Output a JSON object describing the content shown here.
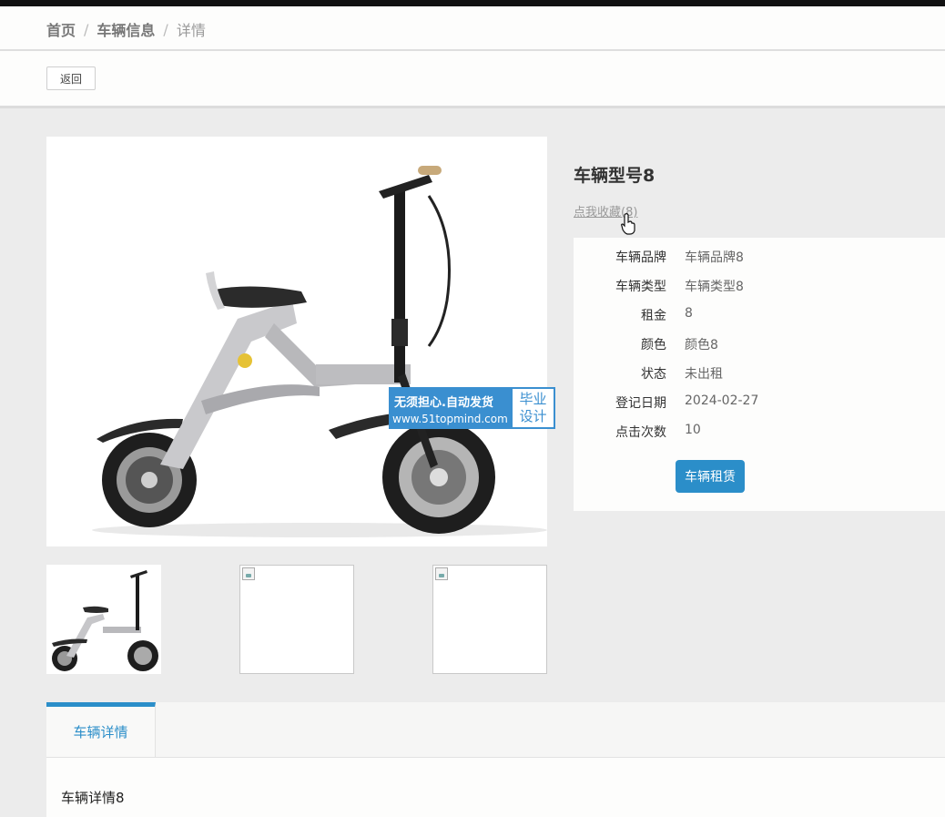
{
  "breadcrumb": {
    "home": "首页",
    "section": "车辆信息",
    "current": "详情",
    "separator": "/"
  },
  "toolbar": {
    "back_label": "返回"
  },
  "product": {
    "title": "车辆型号8",
    "favorite_label": "点我收藏(8)",
    "fields": [
      {
        "label": "车辆品牌",
        "value": "车辆品牌8"
      },
      {
        "label": "车辆类型",
        "value": "车辆类型8"
      },
      {
        "label": "租金",
        "value": "8"
      },
      {
        "label": "颜色",
        "value": "颜色8"
      },
      {
        "label": "状态",
        "value": "未出租"
      },
      {
        "label": "登记日期",
        "value": "2024-02-27"
      },
      {
        "label": "点击次数",
        "value": "10"
      }
    ],
    "rent_button": "车辆租赁"
  },
  "watermark": {
    "line1": "无须担心.自动发货",
    "line2": "www.51topmind.com",
    "badge_top": "毕业",
    "badge_bottom": "设计"
  },
  "tabs": [
    {
      "label": "车辆详情"
    }
  ],
  "detail": {
    "text": "车辆详情8"
  },
  "colors": {
    "accent": "#2b8ec9",
    "watermark": "#3a8fd0"
  }
}
